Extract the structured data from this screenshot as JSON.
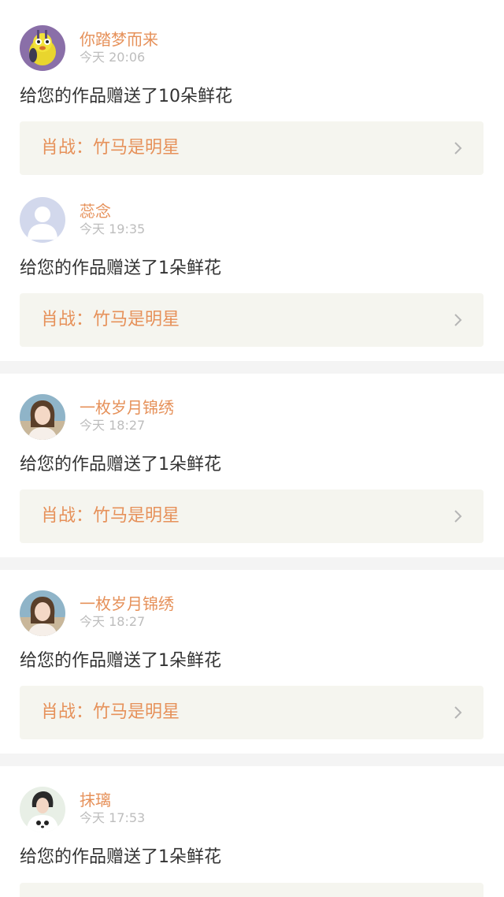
{
  "colors": {
    "accent": "#e6915a",
    "time": "#bdbdbd",
    "text": "#333333",
    "card_bg": "#f5f5ef",
    "separator": "#f4f4f4"
  },
  "items": [
    {
      "avatar": "cartoon-bird-avatar",
      "username": "你踏梦而来",
      "time": "今天 20:06",
      "message": "给您的作品赠送了10朵鲜花",
      "card_title": "肖战：竹马是明星",
      "card_icon": "chevron-right-icon"
    },
    {
      "avatar": "default-user-avatar",
      "username": "蕊念",
      "time": "今天 19:35",
      "message": "给您的作品赠送了1朵鲜花",
      "card_title": "肖战：竹马是明星",
      "card_icon": "chevron-right-icon"
    },
    {
      "avatar": "girl-photo-avatar",
      "username": "一枚岁月锦绣",
      "time": "今天 18:27",
      "message": "给您的作品赠送了1朵鲜花",
      "card_title": "肖战：竹马是明星",
      "card_icon": "chevron-right-icon"
    },
    {
      "avatar": "girl-photo-avatar",
      "username": "一枚岁月锦绣",
      "time": "今天 18:27",
      "message": "给您的作品赠送了1朵鲜花",
      "card_title": "肖战：竹马是明星",
      "card_icon": "chevron-right-icon"
    },
    {
      "avatar": "panda-shirt-avatar",
      "username": "抹璃",
      "time": "今天 17:53",
      "message": "给您的作品赠送了1朵鲜花",
      "card_title": "",
      "card_icon": ""
    }
  ]
}
